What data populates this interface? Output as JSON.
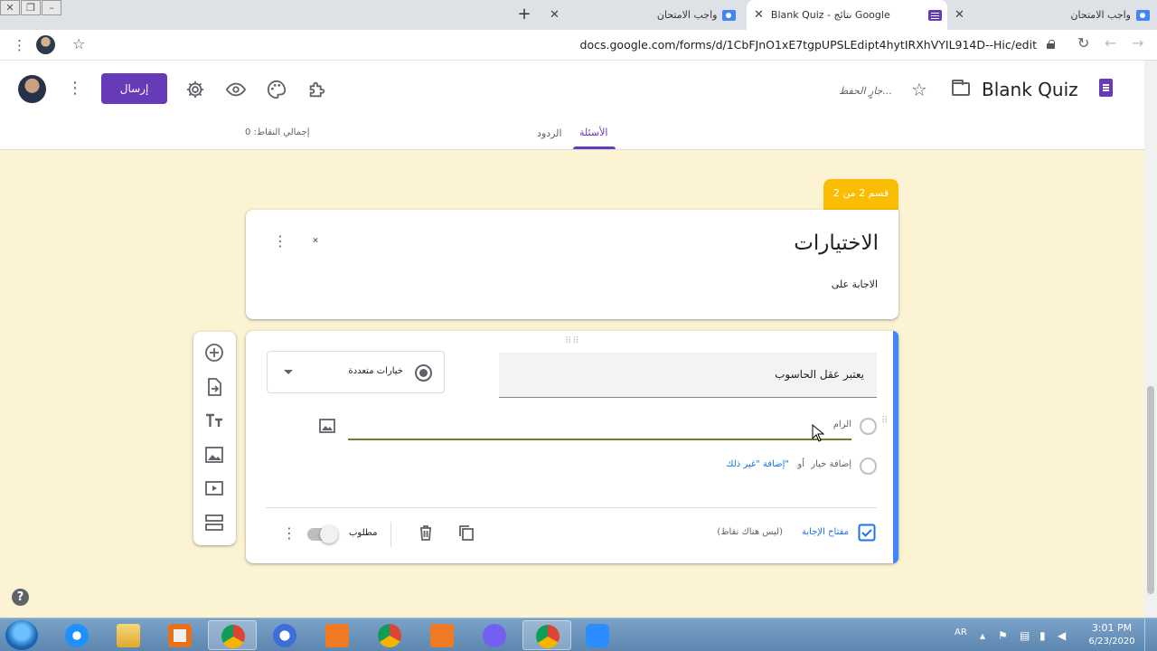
{
  "browser": {
    "tabs": [
      {
        "title": "واجب الامتحان",
        "icon": "contacts-icon"
      },
      {
        "title": "Blank Quiz - نتائج Google",
        "icon": "forms-icon",
        "active": true
      },
      {
        "title": "واجب الامتحان",
        "icon": "contacts-icon"
      }
    ],
    "url": "docs.google.com/forms/d/1CbFJnO1xE7tgpUPSLEdipt4hytIRXhVYIL914D--Hic/edit"
  },
  "form_header": {
    "title": "Blank Quiz",
    "saving_status": "جارٍ الحفظ...",
    "send_label": "إرسال",
    "tab_questions": "الأسئلة",
    "tab_responses": "الردود",
    "total_points": "إجمالي النقاط: 0"
  },
  "section": {
    "tag": "قسم 2 من 2",
    "title": "الاختيارات",
    "description": "الاجابة على"
  },
  "question": {
    "text": "يعتبر عقل الحاسوب",
    "type_label": "خيارات متعددة",
    "option1_text": "الرام",
    "add_option": "إضافة خيار",
    "or_label": "أو",
    "add_other": "إضافة \"غير ذلك\"",
    "answer_key": "مفتاح الإجابة",
    "answer_points": "(ليس هناك نقاط)",
    "required_label": "مطلوب"
  },
  "taskbar": {
    "lang": "AR",
    "time": "3:01 PM",
    "date": "6/23/2020"
  },
  "colors": {
    "accent": "#673ab7",
    "canvas": "#fcf3d3",
    "section_tag": "#fbbc04",
    "question_bar": "#4285f4"
  }
}
